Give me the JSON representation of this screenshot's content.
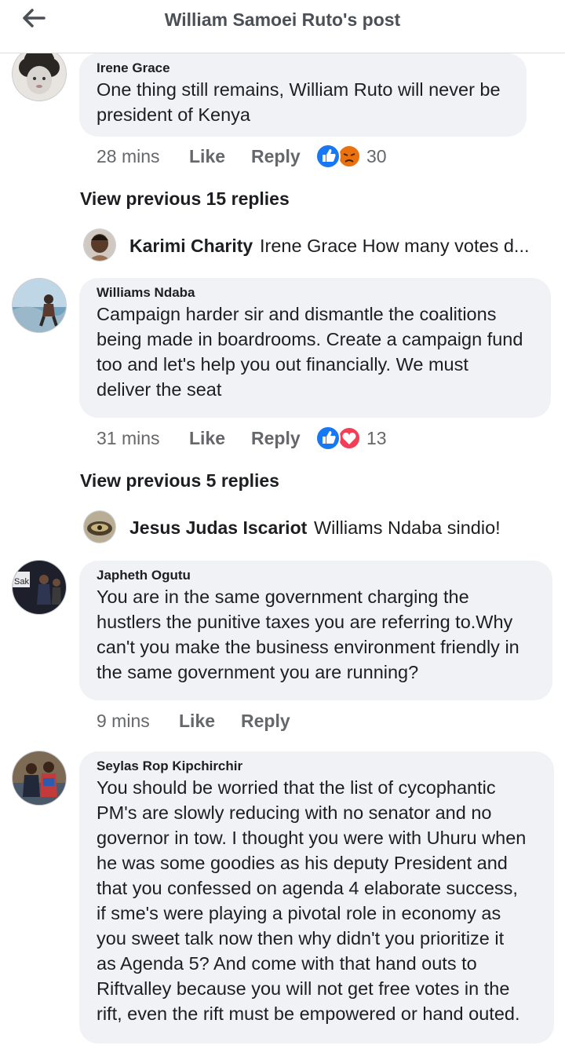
{
  "header": {
    "title": "William Samoei Ruto's post"
  },
  "comments": [
    {
      "name": "Irene Grace",
      "text": [
        "One thing still remains, William Ruto will never be",
        "president of Kenya"
      ],
      "time": "28 mins",
      "like": "Like",
      "reply": "Reply",
      "reactions": [
        "like-reaction-icon",
        "angry-reaction-icon"
      ],
      "reaction_count": "30"
    },
    {
      "name": "Williams Ndaba",
      "text": [
        "Campaign harder sir and dismantle the coalitions",
        "being made in boardrooms. Create a campaign fund",
        "too and let's help you out financially. We must",
        "deliver the seat"
      ],
      "time": "31 mins",
      "like": "Like",
      "reply": "Reply",
      "reactions": [
        "like-reaction-icon",
        "love-reaction-icon"
      ],
      "reaction_count": "13"
    },
    {
      "name": "Japheth Ogutu",
      "text": [
        "You are in the same government charging the",
        "hustlers the punitive  taxes you are referring  to.Why",
        "can't you make the business  environment friendly in",
        "the same government you are running?"
      ],
      "time": "9 mins",
      "like": "Like",
      "reply": "Reply"
    },
    {
      "name": "Seylas Rop Kipchirchir",
      "text": [
        "You should be worried that the list of cycophantic",
        "PM's are slowly reducing with no senator and no",
        "governor in tow. I thought you were with Uhuru when",
        "he was some goodies as his deputy President and",
        "that you confessed on agenda 4 elaborate success,",
        "if sme's were playing a pivotal role in economy as",
        "you sweet talk now then why didn't you prioritize it",
        "as Agenda 5? And come with that hand outs to",
        "Riftvalley because you will not get free votes in the",
        "rift, even the rift must be empowered or hand outed."
      ]
    }
  ],
  "view_previous": [
    "View previous 15 replies",
    "View previous 5 replies"
  ],
  "replies": [
    {
      "name": "Karimi Charity",
      "text": "Irene Grace How many votes d..."
    },
    {
      "name": "Jesus Judas Iscariot",
      "text": "Williams Ndaba sindio!"
    }
  ],
  "colors": {
    "like_blue": "#1877f2",
    "angry_orange": "#e9710f",
    "love_red": "#f33e58",
    "bubble_bg": "#f0f2f5"
  }
}
